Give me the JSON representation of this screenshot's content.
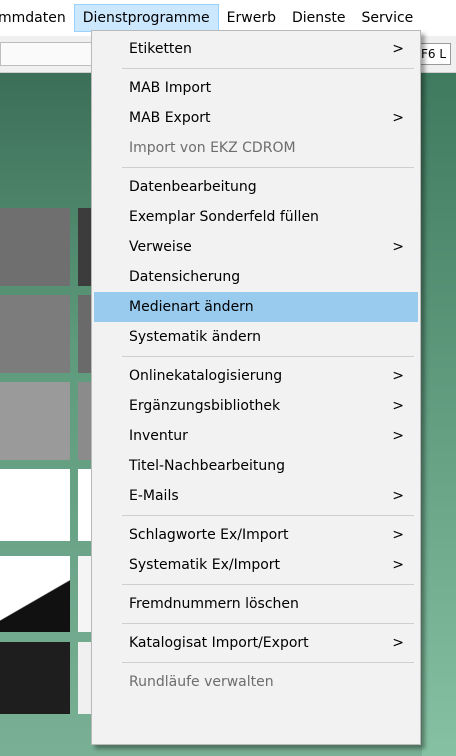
{
  "menubar": {
    "items": [
      {
        "label": "mmdaten",
        "active": false
      },
      {
        "label": "Dienstprogramme",
        "active": true
      },
      {
        "label": "Erwerb",
        "active": false
      },
      {
        "label": "Dienste",
        "active": false
      },
      {
        "label": "Service",
        "active": false
      }
    ]
  },
  "toolbar": {
    "hint": "F6 L"
  },
  "dropdown": {
    "items": [
      {
        "label": "Etiketten",
        "submenu": true
      },
      {
        "label": "MAB Import"
      },
      {
        "label": "MAB Export",
        "submenu": true
      },
      {
        "label": "Import von EKZ CDROM",
        "disabled": true
      },
      {
        "label": "Datenbearbeitung"
      },
      {
        "label": "Exemplar Sonderfeld füllen"
      },
      {
        "label": "Verweise",
        "submenu": true
      },
      {
        "label": "Datensicherung"
      },
      {
        "label": "Medienart ändern",
        "highlighted": true
      },
      {
        "label": "Systematik ändern"
      },
      {
        "label": "Onlinekatalogisierung",
        "submenu": true
      },
      {
        "label": "Ergänzungsbibliothek",
        "submenu": true
      },
      {
        "label": "Inventur",
        "submenu": true
      },
      {
        "label": "Titel-Nachbearbeitung"
      },
      {
        "label": "E-Mails",
        "submenu": true
      },
      {
        "label": "Schlagworte Ex/Import",
        "submenu": true
      },
      {
        "label": "Systematik Ex/Import",
        "submenu": true
      },
      {
        "label": "Fremdnummern löschen"
      },
      {
        "label": "Katalogisat Import/Export",
        "submenu": true
      },
      {
        "label": "Rundläufe verwalten",
        "disabled": true
      }
    ],
    "submenu_arrow": ">"
  },
  "colors": {
    "highlight": "#99cbef",
    "active_menubar": "#cce8ff",
    "desktop": "#3b6f57"
  }
}
